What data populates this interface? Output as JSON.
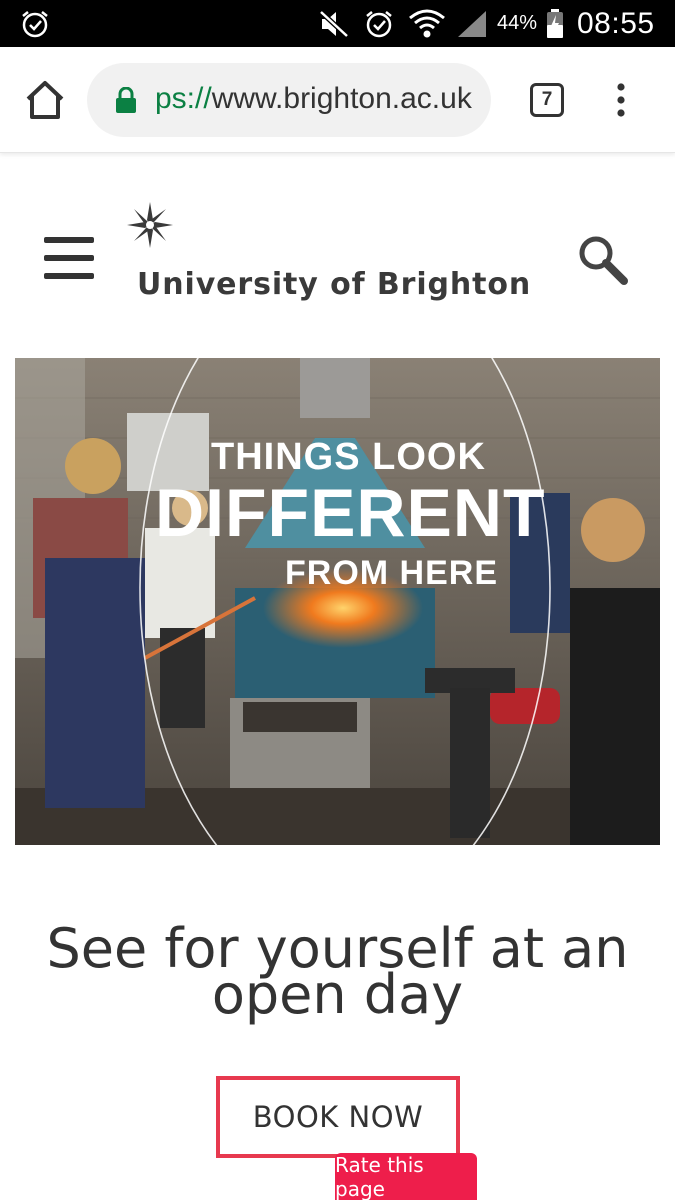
{
  "status_bar": {
    "battery_percent": "44%",
    "time": "08:55",
    "icons": [
      "alarm-icon",
      "mute-icon",
      "alarm-icon",
      "wifi-icon",
      "signal-icon",
      "battery-icon"
    ]
  },
  "browser": {
    "url_scheme_fragment": "ps://",
    "url_host": "www.brighton.ac.uk",
    "tab_count": "7",
    "secure": true,
    "icons": [
      "home-icon",
      "lock-icon",
      "more-vert-icon"
    ]
  },
  "site": {
    "logo_text": "University of Brighton",
    "icons": [
      "menu-icon",
      "star-logo-icon",
      "search-icon"
    ]
  },
  "hero": {
    "line1": "THINGS LOOK",
    "line2": "DIFFERENT",
    "line3": "FROM HERE"
  },
  "openday": {
    "heading": "See for yourself at an open day",
    "book_label": "BOOK NOW"
  },
  "feedback": {
    "rate_label": "Rate this page"
  },
  "colors": {
    "accent_red": "#e7394f",
    "rate_tab": "#ee1e4b",
    "url_secure_green": "#0b8043"
  }
}
